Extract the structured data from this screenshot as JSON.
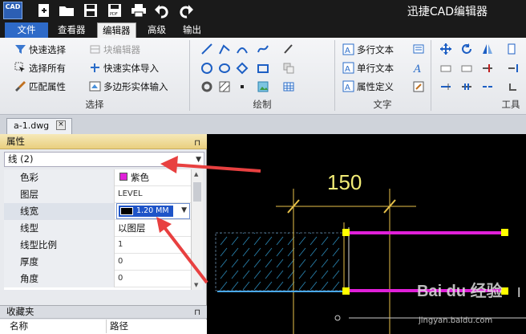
{
  "app": {
    "icon_text": "CAD",
    "title": "迅捷CAD编辑器"
  },
  "menu": [
    "文件",
    "查看器",
    "编辑器",
    "高级",
    "输出"
  ],
  "active_tab": "编辑器",
  "ribbon": {
    "select_group": {
      "label": "选择",
      "buttons": [
        "快速选择",
        "选择所有",
        "匹配属性"
      ],
      "buttons2": [
        "块编辑器",
        "快速实体导入",
        "多边形实体输入"
      ]
    },
    "draw_group": {
      "label": "绘制"
    },
    "text_group": {
      "label": "文字",
      "buttons": [
        "多行文本",
        "单行文本",
        "属性定义"
      ]
    },
    "tools_group": {
      "label": "工具"
    }
  },
  "document": {
    "tab": "a-1.dwg",
    "close": "×"
  },
  "properties": {
    "title": "属性",
    "pin": "⊓",
    "selection": "线 (2)",
    "rows": [
      {
        "name": "色彩",
        "value": "紫色"
      },
      {
        "name": "图层",
        "value": "LEVEL"
      },
      {
        "name": "线宽",
        "value": "1.20 MM"
      },
      {
        "name": "线型",
        "value": "以图层"
      },
      {
        "name": "线型比例",
        "value": "1"
      },
      {
        "name": "厚度",
        "value": "0"
      },
      {
        "name": "角度",
        "value": "0"
      }
    ]
  },
  "favorites": {
    "title": "收藏夹",
    "pin": "⊓",
    "col_name": "名称",
    "col_path": "路径"
  },
  "canvas": {
    "dimension": "150",
    "line_color": "#e020d8",
    "grip_color": "#ffff00",
    "dim_color": "#f2ec76"
  },
  "watermark": {
    "logo": "Bai du 经验",
    "url": "jingyan.baidu.com"
  },
  "side_glyph": "l",
  "colors": {
    "annotation_arrow": "#e84040",
    "file_tab": "#2e6ac8",
    "selection": "#1e54c8"
  }
}
